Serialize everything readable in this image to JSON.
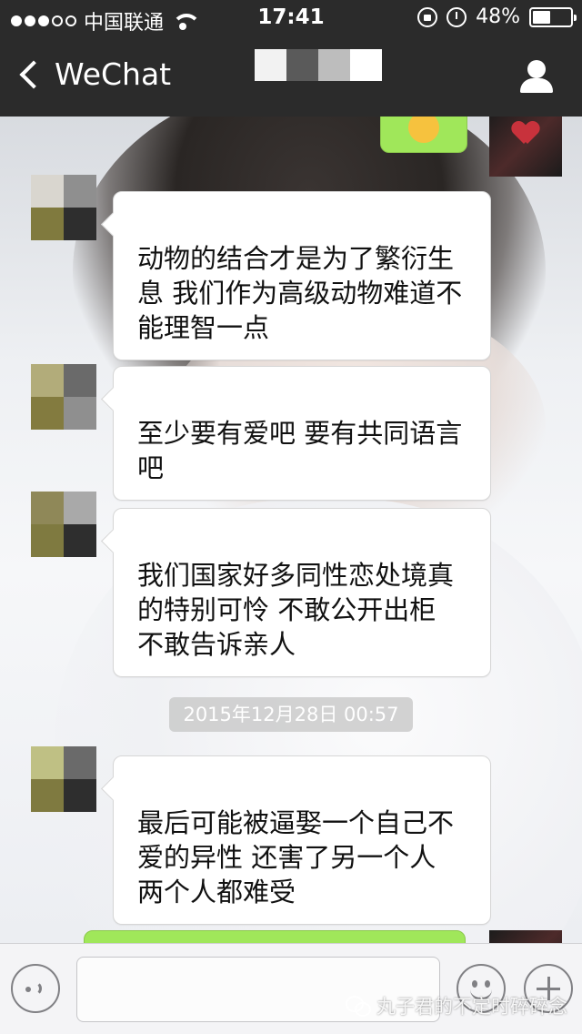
{
  "status_bar": {
    "carrier": "中国联通",
    "time": "17:41",
    "battery": "48%",
    "battery_level": 0.48,
    "signal_dots_filled": 3,
    "signal_dots_total": 5
  },
  "nav": {
    "back_label": "WeChat"
  },
  "messages": [
    {
      "text": "动物的结合才是为了繁衍生\n息 我们作为高级动物难道不\n能理智一点"
    },
    {
      "text": "至少要有爱吧 要有共同语言\n吧"
    },
    {
      "text": "我们国家好多同性恋处境真\n的特别可怜 不敢公开出柜\n不敢告诉亲人"
    },
    {
      "text": "最后可能被逼娶一个自己不\n爱的异性 还害了另一个人\n两个人都难受"
    }
  ],
  "timestamp": "2015年12月28日 00:57",
  "watermark": "丸子君的不定时碎碎念",
  "colors": {
    "nav_bg": "#2b2b2b",
    "sent_bubble": "#a0e75a",
    "received_bubble": "#ffffff"
  }
}
